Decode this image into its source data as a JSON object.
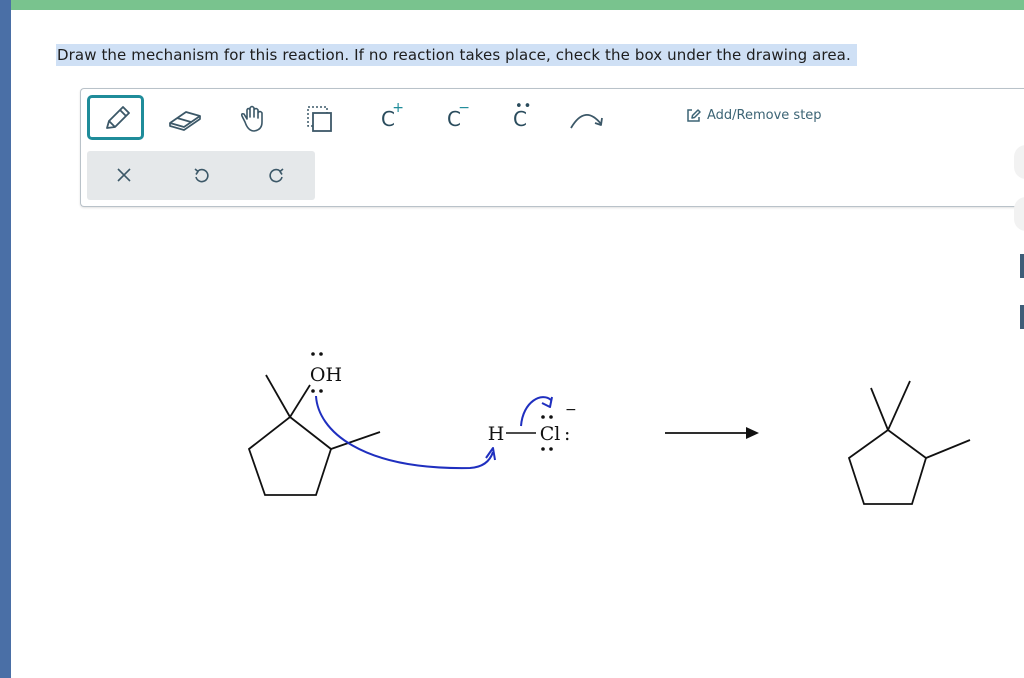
{
  "instruction": "Draw the mechanism for this reaction. If no reaction takes place, check the box under the drawing area.",
  "toolbar": {
    "tools": [
      {
        "name": "pencil-icon",
        "selected": true
      },
      {
        "name": "eraser-icon"
      },
      {
        "name": "hand-icon"
      },
      {
        "name": "select-icon"
      },
      {
        "name": "carbocation-icon",
        "label": "C",
        "charge": "+"
      },
      {
        "name": "carbanion-icon",
        "label": "C",
        "charge": "−"
      },
      {
        "name": "radical-icon",
        "label": "C"
      },
      {
        "name": "arrow-icon"
      }
    ],
    "add_remove_label": "Add/Remove step",
    "actions": [
      {
        "name": "clear-icon"
      },
      {
        "name": "undo-icon"
      },
      {
        "name": "redo-icon"
      }
    ]
  },
  "molecules": {
    "oh_label": "OH",
    "h_label": "H",
    "cl_label": "Cl",
    "cl_colon": ":",
    "charge": "−"
  },
  "colors": {
    "accent": "#1f8c9a",
    "arrow_blue": "#1f2fbf",
    "top_bar": "#79c38e",
    "left_bar": "#4a6fa6",
    "highlight": "#cfe0f5"
  }
}
